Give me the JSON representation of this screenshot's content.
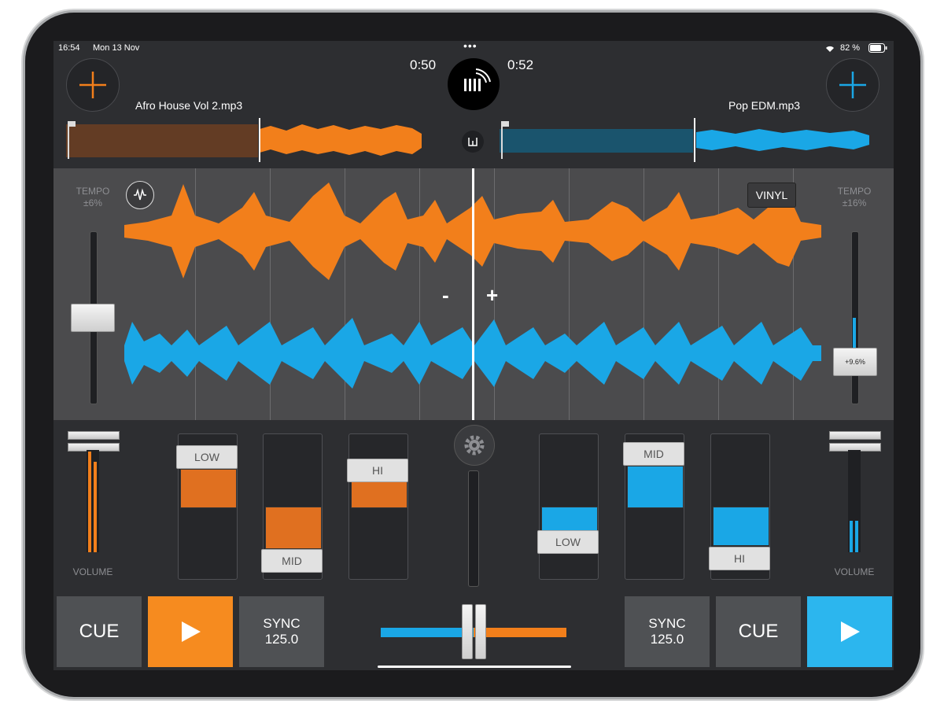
{
  "status_bar": {
    "time": "16:54",
    "date": "Mon 13 Nov",
    "battery": "82 %"
  },
  "left_deck": {
    "track": "Afro House Vol 2.mp3",
    "elapsed": "0:50",
    "tempo_label": "TEMPO",
    "tempo_range": "±6%",
    "volume_label": "VOLUME",
    "eq": {
      "low": "LOW",
      "mid": "MID",
      "hi": "HI"
    },
    "cue_label": "CUE",
    "sync_label": "SYNC",
    "bpm": "125.0",
    "color": "#f27f1b"
  },
  "right_deck": {
    "track": "Pop EDM.mp3",
    "elapsed": "0:52",
    "tempo_label": "TEMPO",
    "tempo_range": "±16%",
    "tempo_value": "+9.6%",
    "vinyl_label": "VINYL",
    "volume_label": "VOLUME",
    "eq": {
      "low": "LOW",
      "mid": "MID",
      "hi": "HI"
    },
    "cue_label": "CUE",
    "sync_label": "SYNC",
    "bpm": "125.0",
    "color": "#1aa7e6"
  },
  "center": {
    "minus": "-",
    "plus": "+"
  },
  "icons": {
    "add": "plus-icon",
    "logo": "equalizer-logo-icon",
    "settings": "gear-icon",
    "split": "split-icon",
    "wave": "waveform-icon",
    "play": "play-icon",
    "wifi": "wifi-icon",
    "battery": "battery-icon"
  }
}
